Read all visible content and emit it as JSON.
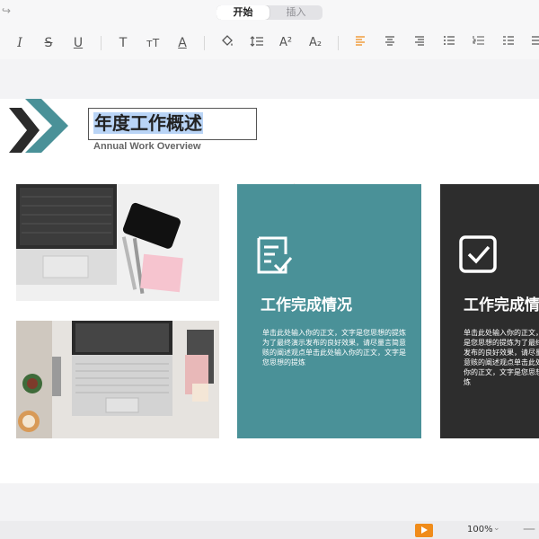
{
  "topbar": {
    "tabs": [
      {
        "label": "开始",
        "active": true
      },
      {
        "label": "插入",
        "active": false
      }
    ]
  },
  "toolbar": {
    "icons": [
      "italic-icon",
      "strikethrough-icon",
      "underline-icon",
      "text-style-icon",
      "text-size-icon",
      "font-color-icon",
      "fill-color-icon",
      "line-spacing-icon",
      "superscript-icon",
      "subscript-icon",
      "align-left-icon",
      "align-center-icon",
      "align-right-icon",
      "bullet-list-icon",
      "numbered-list-icon",
      "indent-list-icon"
    ],
    "glyphs": {
      "italic": "I",
      "strike": "S",
      "underline": "U",
      "text_style": "T",
      "text_size": "ᴛT",
      "font_color": "A",
      "superscript": "A²",
      "subscript": "A₂"
    },
    "accent": "#f08c1a"
  },
  "slide": {
    "title": "年度工作概述",
    "subtitle": "Annual Work Overview",
    "cards": [
      {
        "title": "工作完成情况",
        "body": "单击此处输入你的正文，文字是您思想的提炼为了最终演示发布的良好效果，请尽量言简意赅的阐述观点单击此处输入你的正文，文字是您思想的提炼",
        "color": "#4a9198"
      },
      {
        "title": "工作完成情",
        "body": "单击此处输入你的正文，文字是您思想的提炼为了最终演示发布的良好效果，请尽量言简意赅的阐述观点单击此处输入你的正文，文字是您思想的提炼",
        "color": "#2d2d2d"
      }
    ],
    "logo_colors": {
      "dark": "#2b2b2b",
      "teal": "#4a9198"
    }
  },
  "statusbar": {
    "zoom": "100%",
    "zoom_caret": "⌄",
    "minus": "—"
  },
  "icons": {
    "redo": "↪"
  }
}
